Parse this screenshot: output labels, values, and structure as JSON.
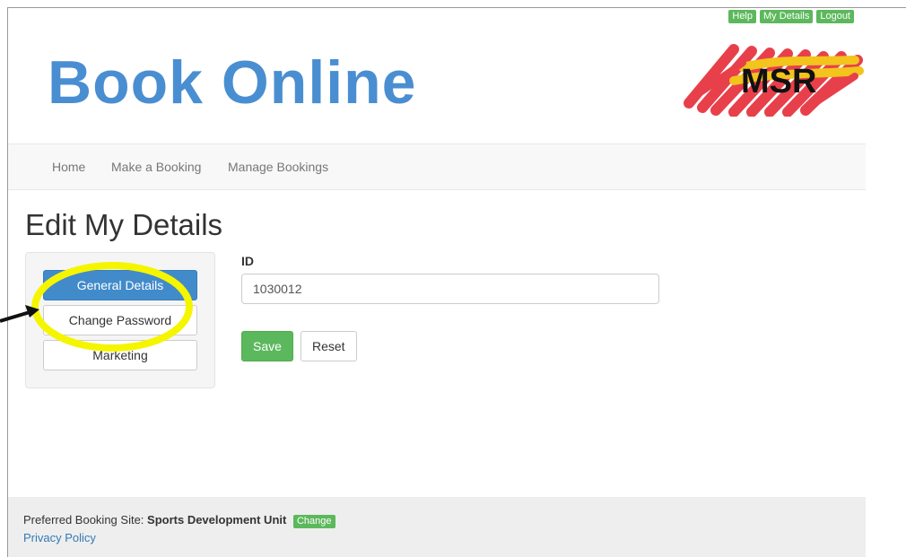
{
  "top_links": [
    "Help",
    "My Details",
    "Logout"
  ],
  "brand": "Book Online",
  "logo_text": "MSR",
  "nav": [
    "Home",
    "Make a Booking",
    "Manage Bookings"
  ],
  "page_title": "Edit My Details",
  "sidebar": {
    "items": [
      {
        "label": "General Details",
        "active": true
      },
      {
        "label": "Change Password",
        "active": false
      },
      {
        "label": "Marketing",
        "active": false
      }
    ]
  },
  "form": {
    "id_label": "ID",
    "id_value": "1030012",
    "save": "Save",
    "reset": "Reset"
  },
  "footer": {
    "site_label": "Preferred Booking Site:",
    "site_name": "Sports Development Unit",
    "change": "Change",
    "privacy": "Privacy Policy"
  },
  "colors": {
    "brand": "#4a8ed2",
    "success": "#5cb85c",
    "primary": "#428bca",
    "highlight": "#f5f500"
  }
}
